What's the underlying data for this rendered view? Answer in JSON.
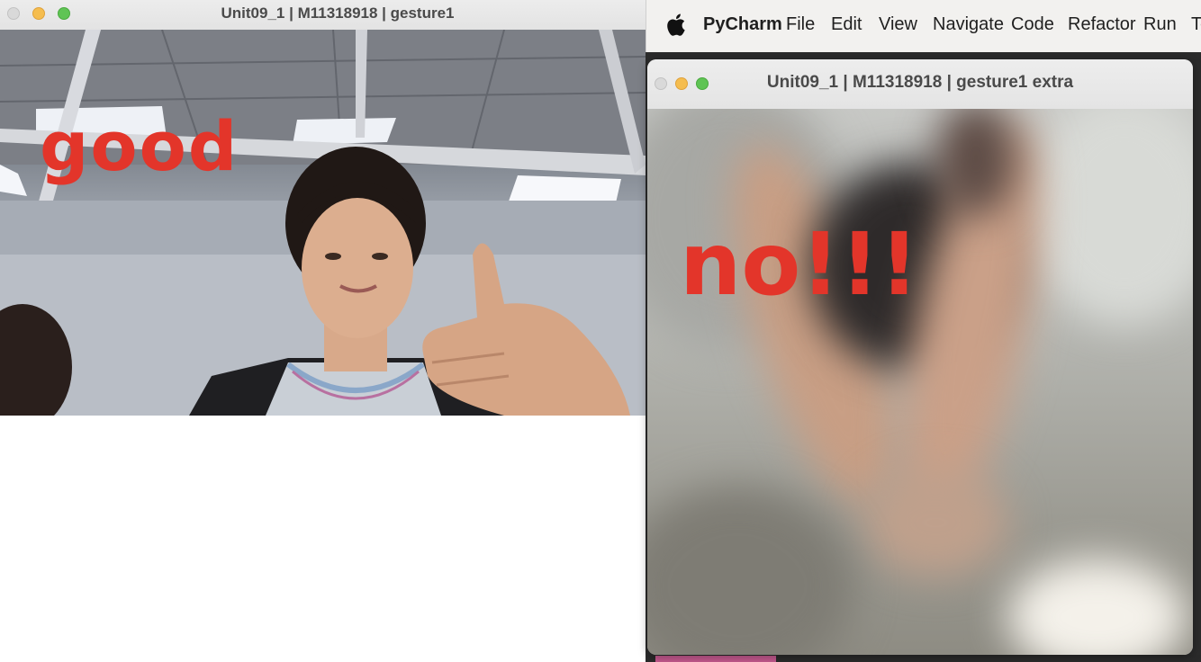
{
  "left_window": {
    "title": "Unit09_1 | M11318918 | gesture1",
    "overlay_text": "good"
  },
  "menubar": {
    "apple_icon": "apple-icon",
    "items": [
      "PyCharm",
      "File",
      "Edit",
      "View",
      "Navigate",
      "Code",
      "Refactor",
      "Run",
      "To"
    ]
  },
  "right_window": {
    "title": "Unit09_1 | M11318918 | gesture1 extra",
    "overlay_text": "no!!!"
  },
  "colors": {
    "overlay_red": "#e3352a",
    "traffic_close": "#d9d9d9",
    "traffic_min": "#f5bd4f",
    "traffic_max": "#5fc454"
  }
}
